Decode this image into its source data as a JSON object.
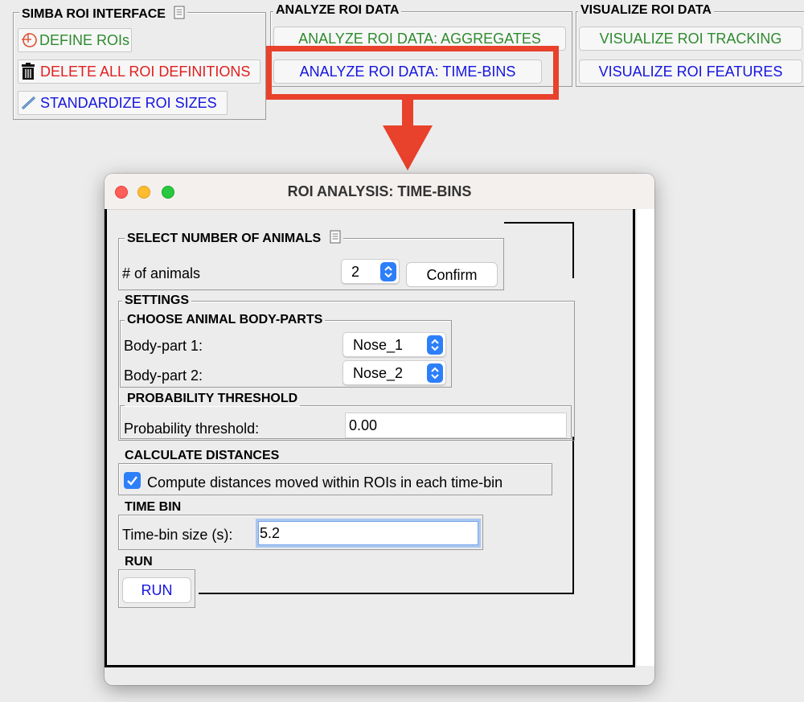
{
  "top": {
    "roi_interface": {
      "title": "SIMBA ROI INTERFACE",
      "define_label": "DEFINE ROIs",
      "delete_label": "DELETE ALL ROI DEFINITIONS",
      "standardize_label": "STANDARDIZE ROI SIZES"
    },
    "analyze": {
      "title": "ANALYZE ROI DATA",
      "aggregates_label": "ANALYZE ROI DATA: AGGREGATES",
      "timebins_label": "ANALYZE ROI DATA: TIME-BINS"
    },
    "visualize": {
      "title": "VISUALIZE ROI DATA",
      "tracking_label": "VISUALIZE ROI TRACKING",
      "features_label": "VISUALIZE ROI FEATURES"
    }
  },
  "colors": {
    "highlight": "#e8412c",
    "green_text": "#2e8b2e",
    "red_text": "#e01f1f",
    "blue_text": "#1414e0",
    "accent": "#2d7ff9"
  },
  "window": {
    "title": "ROI ANALYSIS: TIME-BINS",
    "animals": {
      "title": "SELECT NUMBER OF ANIMALS",
      "label": "# of animals",
      "value": "2",
      "confirm_label": "Confirm"
    },
    "settings": {
      "title": "SETTINGS",
      "bodyparts": {
        "title": "CHOOSE ANIMAL BODY-PARTS",
        "bp1_label": "Body-part 1:",
        "bp1_value": "Nose_1",
        "bp2_label": "Body-part 2:",
        "bp2_value": "Nose_2"
      },
      "probability": {
        "title": "PROBABILITY THRESHOLD",
        "label": "Probability threshold:",
        "value": "0.00"
      }
    },
    "distances": {
      "title": "CALCULATE DISTANCES",
      "checkbox_label": "Compute distances moved within ROIs in each time-bin",
      "checked": true
    },
    "timebin": {
      "title": "TIME BIN",
      "label": "Time-bin size (s):",
      "value": "5.2"
    },
    "run": {
      "title": "RUN",
      "button_label": "RUN"
    }
  }
}
